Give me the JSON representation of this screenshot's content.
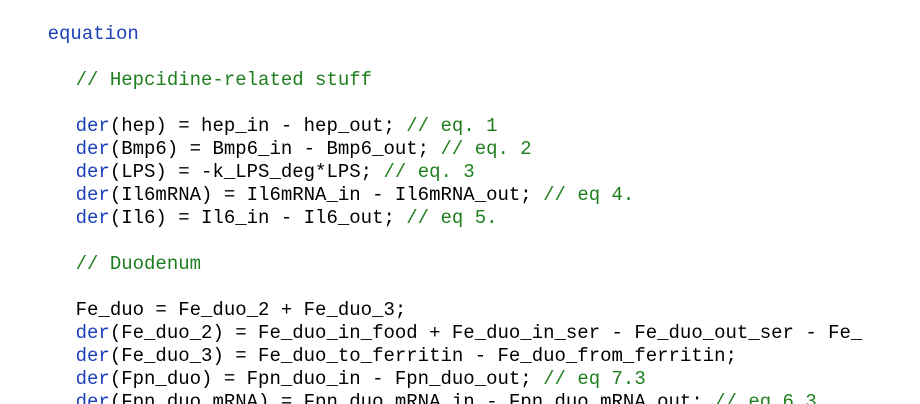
{
  "code": {
    "keyword_equation": "equation",
    "comment_hepcidine": "// Hepcidine-related stuff",
    "comment_duodenum": "// Duodenum",
    "lines": [
      {
        "fn": "der",
        "rest": "(hep) = hep_in - hep_out; ",
        "comment": "// eq. 1"
      },
      {
        "fn": "der",
        "rest": "(Bmp6) = Bmp6_in - Bmp6_out; ",
        "comment": "// eq. 2"
      },
      {
        "fn": "der",
        "rest": "(LPS) = -k_LPS_deg*LPS; ",
        "comment": "// eq. 3"
      },
      {
        "fn": "der",
        "rest": "(Il6mRNA) = Il6mRNA_in - Il6mRNA_out; ",
        "comment": "// eq 4."
      },
      {
        "fn": "der",
        "rest": "(Il6) = Il6_in - Il6_out; ",
        "comment": "// eq 5."
      },
      {
        "fn": "",
        "rest": "Fe_duo = Fe_duo_2 + Fe_duo_3;",
        "comment": ""
      },
      {
        "fn": "der",
        "rest": "(Fe_duo_2) = Fe_duo_in_food + Fe_duo_in_ser - Fe_duo_out_ser - Fe_",
        "comment": ""
      },
      {
        "fn": "der",
        "rest": "(Fe_duo_3) = Fe_duo_to_ferritin - Fe_duo_from_ferritin;",
        "comment": ""
      },
      {
        "fn": "der",
        "rest": "(Fpn_duo) = Fpn_duo_in - Fpn_duo_out; ",
        "comment": "// eq 7.3"
      },
      {
        "fn": "der",
        "rest": "(Fpn_duo_mRNA) = Fpn_duo_mRNA_in - Fpn_duo_mRNA_out; ",
        "comment": "// eq 6.3"
      }
    ]
  },
  "colors": {
    "keyword": "#1a3fb8",
    "comment": "#1e7f1e",
    "text": "#000000",
    "background": "#ffffff"
  }
}
